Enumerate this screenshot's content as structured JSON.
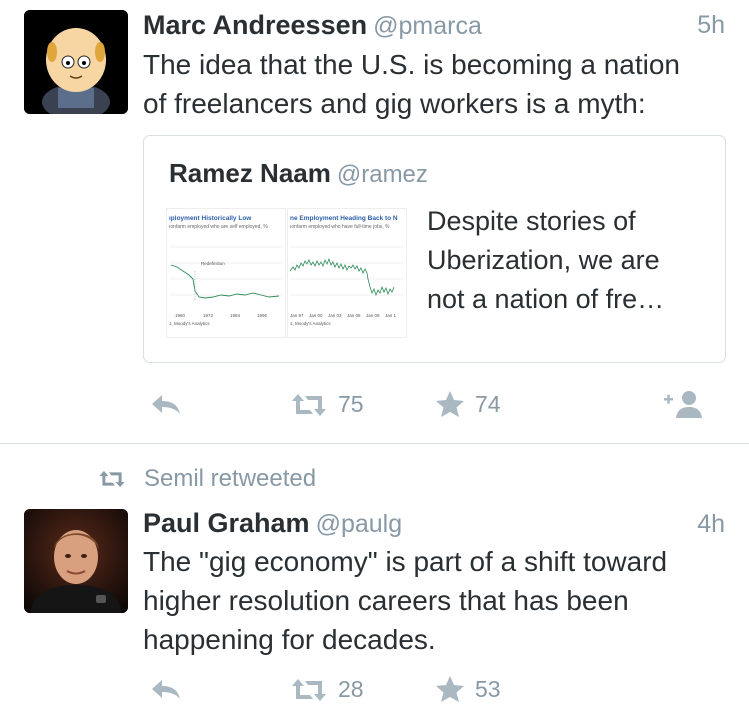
{
  "tweets": [
    {
      "author_name": "Marc Andreessen",
      "handle": "@pmarca",
      "time": "5h",
      "text_lines": [
        "The idea that the U.S. is becoming a nation",
        "of freelancers and gig workers is a myth:"
      ],
      "quoted": {
        "author_name": "Ramez Naam",
        "handle": "@ramez",
        "text_lines": [
          "Despite stories of",
          "Uberization, we are",
          "not a nation of fre…"
        ],
        "thumb_left": {
          "title": "ıployment Historically Low",
          "subtitle": "ıonfarm employed who are self employed, %",
          "annotation": "Redefinition",
          "ticks": [
            "1960",
            "1972",
            "1984",
            "1996"
          ],
          "source": "1, Moody's Analytics"
        },
        "thumb_right": {
          "title": "ne Employment Heading Back to N",
          "subtitle": "ıonfarm employed who have full-time jobs, %",
          "ticks": [
            "Jan 97",
            "Jan 00",
            "Jan 03",
            "Jan 06",
            "Jan 09",
            "Jan 1"
          ],
          "source": "1, Moody's Analytics"
        }
      },
      "retweets": "75",
      "favorites": "74"
    },
    {
      "retweet_context": "Semil retweeted",
      "author_name": "Paul Graham",
      "handle": "@paulg",
      "time": "4h",
      "text_lines": [
        "The \"gig economy\" is part of a shift toward",
        "higher resolution careers that has been",
        "happening for decades."
      ],
      "retweets": "28",
      "favorites": "53"
    }
  ],
  "icons": {
    "reply": "reply-icon",
    "retweet": "retweet-icon",
    "favorite": "star-icon",
    "follow": "follow-icon"
  },
  "colors": {
    "text": "#292f33",
    "secondary": "#8899a6",
    "border": "#d8dee2"
  }
}
